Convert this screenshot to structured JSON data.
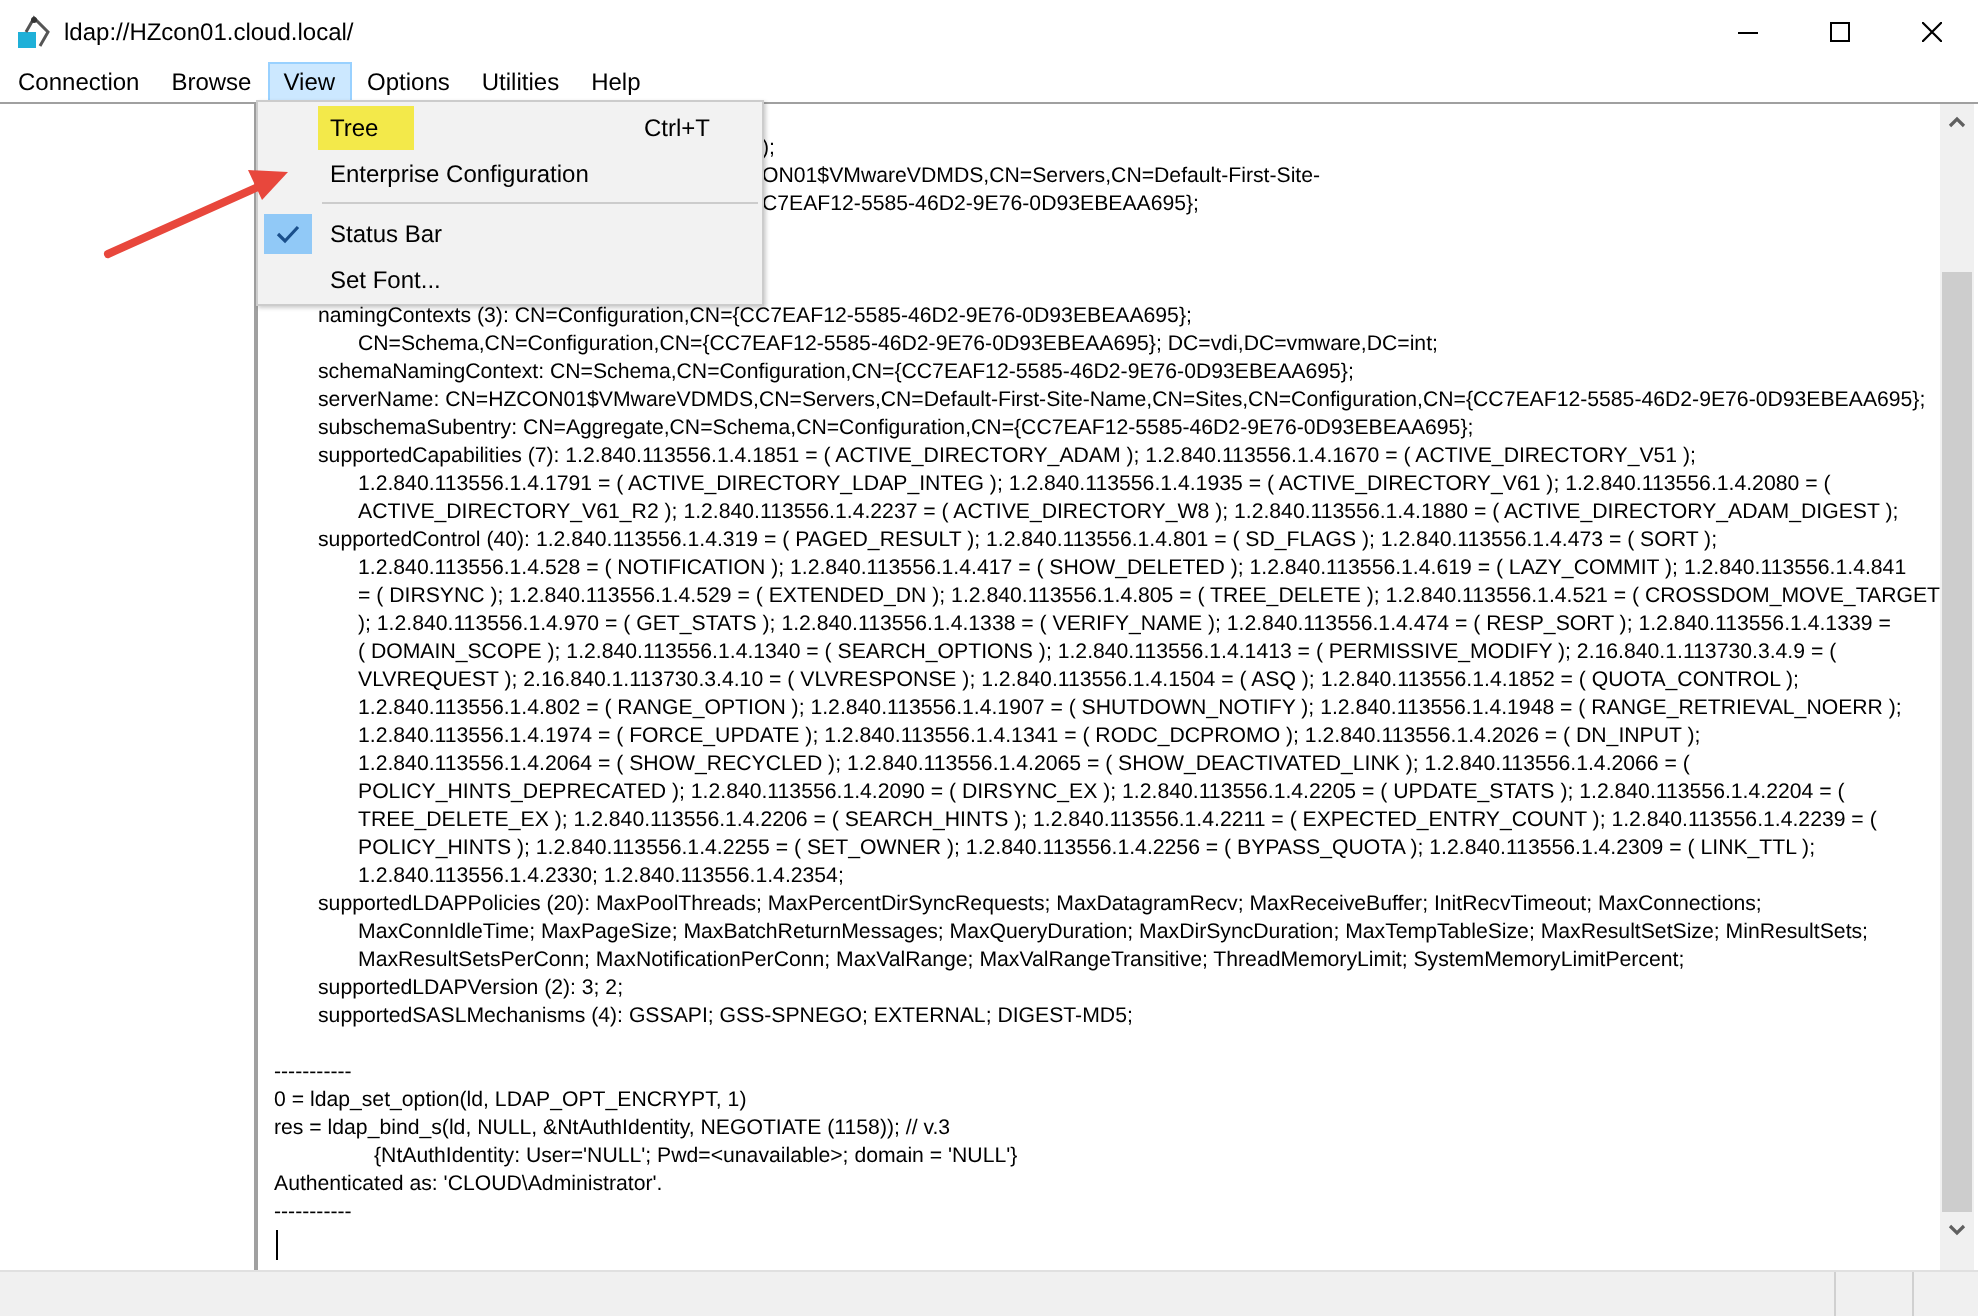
{
  "window": {
    "title": "ldap://HZcon01.cloud.local/"
  },
  "menu_bar": [
    {
      "label": "Connection",
      "selected": false
    },
    {
      "label": "Browse",
      "selected": false
    },
    {
      "label": "View",
      "selected": true
    },
    {
      "label": "Options",
      "selected": false
    },
    {
      "label": "Utilities",
      "selected": false
    },
    {
      "label": "Help",
      "selected": false
    }
  ],
  "view_menu": [
    {
      "kind": "item",
      "label": "Tree",
      "shortcut": "Ctrl+T",
      "highlighted": true,
      "checked": false
    },
    {
      "kind": "item",
      "label": "Enterprise Configuration",
      "highlighted": false,
      "checked": false
    },
    {
      "kind": "separator"
    },
    {
      "kind": "item",
      "label": "Status Bar",
      "highlighted": false,
      "checked": true
    },
    {
      "kind": "item",
      "label": "Set Font...",
      "highlighted": false,
      "checked": false
    }
  ],
  "covered_lines": [
    {
      "text": ");"
    },
    {
      "text": "ON01$VMwareVDMDS,CN=Servers,CN=Default-First-Site-"
    },
    {
      "text": "C7EAF12-5585-46D2-9E76-0D93EBEAA695};"
    }
  ],
  "lines": [
    {
      "kind": "attribute",
      "text": "namingContexts (3): CN=Configuration,CN={CC7EAF12-5585-46D2-9E76-0D93EBEAA695};"
    },
    {
      "kind": "continuation",
      "text": "CN=Schema,CN=Configuration,CN={CC7EAF12-5585-46D2-9E76-0D93EBEAA695}; DC=vdi,DC=vmware,DC=int;"
    },
    {
      "kind": "attribute",
      "text": "schemaNamingContext: CN=Schema,CN=Configuration,CN={CC7EAF12-5585-46D2-9E76-0D93EBEAA695};"
    },
    {
      "kind": "attribute",
      "text": "serverName: CN=HZCON01$VMwareVDMDS,CN=Servers,CN=Default-First-Site-Name,CN=Sites,CN=Configuration,CN={CC7EAF12-5585-46D2-9E76-0D93EBEAA695};"
    },
    {
      "kind": "attribute",
      "text": "subschemaSubentry: CN=Aggregate,CN=Schema,CN=Configuration,CN={CC7EAF12-5585-46D2-9E76-0D93EBEAA695};"
    },
    {
      "kind": "attribute",
      "text": "supportedCapabilities (7): 1.2.840.113556.1.4.1851 = ( ACTIVE_DIRECTORY_ADAM ); 1.2.840.113556.1.4.1670 = ( ACTIVE_DIRECTORY_V51 );"
    },
    {
      "kind": "continuation",
      "text": "1.2.840.113556.1.4.1791 = ( ACTIVE_DIRECTORY_LDAP_INTEG ); 1.2.840.113556.1.4.1935 = ( ACTIVE_DIRECTORY_V61 ); 1.2.840.113556.1.4.2080 = ("
    },
    {
      "kind": "continuation",
      "text": "ACTIVE_DIRECTORY_V61_R2 ); 1.2.840.113556.1.4.2237 = ( ACTIVE_DIRECTORY_W8 ); 1.2.840.113556.1.4.1880 = ( ACTIVE_DIRECTORY_ADAM_DIGEST );"
    },
    {
      "kind": "attribute",
      "text": "supportedControl (40): 1.2.840.113556.1.4.319 = ( PAGED_RESULT ); 1.2.840.113556.1.4.801 = ( SD_FLAGS ); 1.2.840.113556.1.4.473 = ( SORT );"
    },
    {
      "kind": "continuation",
      "text": "1.2.840.113556.1.4.528 = ( NOTIFICATION ); 1.2.840.113556.1.4.417 = ( SHOW_DELETED ); 1.2.840.113556.1.4.619 = ( LAZY_COMMIT ); 1.2.840.113556.1.4.841"
    },
    {
      "kind": "continuation",
      "text": "= ( DIRSYNC ); 1.2.840.113556.1.4.529 = ( EXTENDED_DN ); 1.2.840.113556.1.4.805 = ( TREE_DELETE ); 1.2.840.113556.1.4.521 = ( CROSSDOM_MOVE_TARGET"
    },
    {
      "kind": "continuation",
      "text": "); 1.2.840.113556.1.4.970 = ( GET_STATS ); 1.2.840.113556.1.4.1338 = ( VERIFY_NAME ); 1.2.840.113556.1.4.474 = ( RESP_SORT ); 1.2.840.113556.1.4.1339 ="
    },
    {
      "kind": "continuation",
      "text": "( DOMAIN_SCOPE ); 1.2.840.113556.1.4.1340 = ( SEARCH_OPTIONS ); 1.2.840.113556.1.4.1413 = ( PERMISSIVE_MODIFY ); 2.16.840.1.113730.3.4.9 = ("
    },
    {
      "kind": "continuation",
      "text": "VLVREQUEST ); 2.16.840.1.113730.3.4.10 = ( VLVRESPONSE ); 1.2.840.113556.1.4.1504 = ( ASQ ); 1.2.840.113556.1.4.1852 = ( QUOTA_CONTROL );"
    },
    {
      "kind": "continuation",
      "text": "1.2.840.113556.1.4.802 = ( RANGE_OPTION ); 1.2.840.113556.1.4.1907 = ( SHUTDOWN_NOTIFY ); 1.2.840.113556.1.4.1948 = ( RANGE_RETRIEVAL_NOERR );"
    },
    {
      "kind": "continuation",
      "text": "1.2.840.113556.1.4.1974 = ( FORCE_UPDATE ); 1.2.840.113556.1.4.1341 = ( RODC_DCPROMO ); 1.2.840.113556.1.4.2026 = ( DN_INPUT );"
    },
    {
      "kind": "continuation",
      "text": "1.2.840.113556.1.4.2064 = ( SHOW_RECYCLED ); 1.2.840.113556.1.4.2065 = ( SHOW_DEACTIVATED_LINK ); 1.2.840.113556.1.4.2066 = ("
    },
    {
      "kind": "continuation",
      "text": "POLICY_HINTS_DEPRECATED ); 1.2.840.113556.1.4.2090 = ( DIRSYNC_EX ); 1.2.840.113556.1.4.2205 = ( UPDATE_STATS ); 1.2.840.113556.1.4.2204 = ("
    },
    {
      "kind": "continuation",
      "text": "TREE_DELETE_EX ); 1.2.840.113556.1.4.2206 = ( SEARCH_HINTS ); 1.2.840.113556.1.4.2211 = ( EXPECTED_ENTRY_COUNT ); 1.2.840.113556.1.4.2239 = ("
    },
    {
      "kind": "continuation",
      "text": "POLICY_HINTS ); 1.2.840.113556.1.4.2255 = ( SET_OWNER ); 1.2.840.113556.1.4.2256 = ( BYPASS_QUOTA ); 1.2.840.113556.1.4.2309 = ( LINK_TTL );"
    },
    {
      "kind": "continuation",
      "text": "1.2.840.113556.1.4.2330; 1.2.840.113556.1.4.2354;"
    },
    {
      "kind": "attribute",
      "text": "supportedLDAPPolicies (20): MaxPoolThreads; MaxPercentDirSyncRequests; MaxDatagramRecv; MaxReceiveBuffer; InitRecvTimeout; MaxConnections;"
    },
    {
      "kind": "continuation",
      "text": "MaxConnIdleTime; MaxPageSize; MaxBatchReturnMessages; MaxQueryDuration; MaxDirSyncDuration; MaxTempTableSize; MaxResultSetSize; MinResultSets;"
    },
    {
      "kind": "continuation",
      "text": "MaxResultSetsPerConn; MaxNotificationPerConn; MaxValRange; MaxValRangeTransitive; ThreadMemoryLimit; SystemMemoryLimitPercent;"
    },
    {
      "kind": "attribute",
      "text": "supportedLDAPVersion (2): 3; 2;"
    },
    {
      "kind": "attribute",
      "text": "supportedSASLMechanisms (4): GSSAPI; GSS-SPNEGO; EXTERNAL; DIGEST-MD5;"
    },
    {
      "kind": "separator",
      "text": "-----------"
    },
    {
      "kind": "plain",
      "text": "0 = ldap_set_option(ld, LDAP_OPT_ENCRYPT, 1)"
    },
    {
      "kind": "plain",
      "text": "res = ldap_bind_s(ld, NULL, &NtAuthIdentity, NEGOTIATE (1158)); // v.3"
    },
    {
      "kind": "detail",
      "text": "{NtAuthIdentity: User='NULL'; Pwd=<unavailable>; domain = 'NULL'}"
    },
    {
      "kind": "plain",
      "text": "Authenticated as: 'CLOUD\\Administrator'."
    },
    {
      "kind": "plain",
      "text": "-----------"
    }
  ]
}
